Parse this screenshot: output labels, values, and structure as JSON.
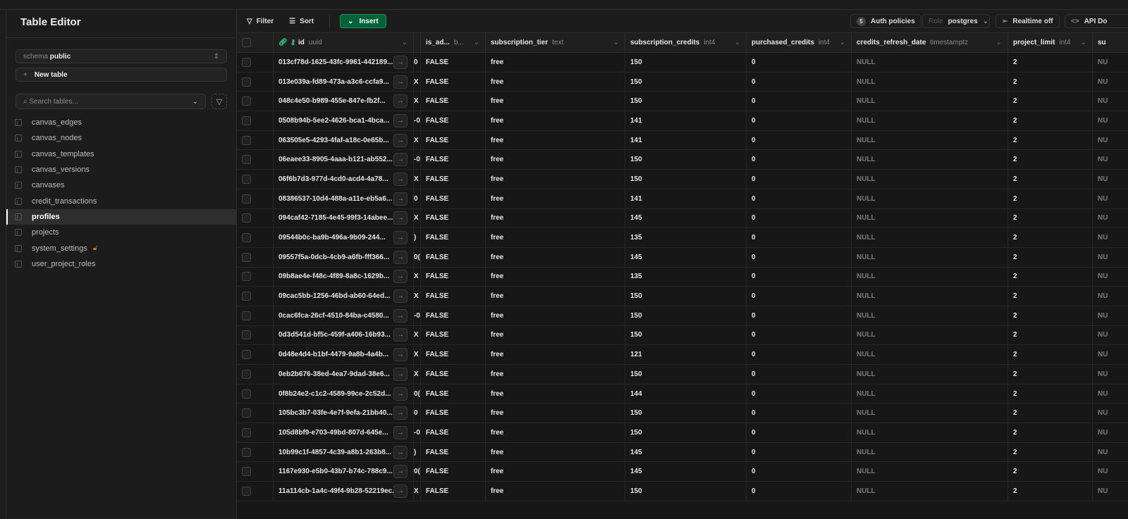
{
  "sidebar": {
    "title": "Table Editor",
    "schema_label": "schema",
    "schema_value": "public",
    "new_table": "New table",
    "search_placeholder": "Search tables...",
    "tables": [
      {
        "name": "canvas_edges"
      },
      {
        "name": "canvas_nodes"
      },
      {
        "name": "canvas_templates"
      },
      {
        "name": "canvas_versions"
      },
      {
        "name": "canvases"
      },
      {
        "name": "credit_transactions"
      },
      {
        "name": "profiles",
        "active": true
      },
      {
        "name": "projects"
      },
      {
        "name": "system_settings",
        "locked": true
      },
      {
        "name": "user_project_roles"
      }
    ]
  },
  "toolbar": {
    "filter": "Filter",
    "sort": "Sort",
    "insert": "Insert",
    "auth_count": "5",
    "auth_policies": "Auth policies",
    "role_label": "Role",
    "role_value": "postgres",
    "realtime": "Realtime off",
    "api_docs": "API Do"
  },
  "colors": {
    "accent": "#006239",
    "lock": "#c27c1a"
  },
  "columns": [
    {
      "name": "id",
      "type": "uuid"
    },
    {
      "name": "is_ad...",
      "type": "b..."
    },
    {
      "name": "subscription_tier",
      "type": "text"
    },
    {
      "name": "subscription_credits",
      "type": "int4"
    },
    {
      "name": "purchased_credits",
      "type": "int4"
    },
    {
      "name": "credits_refresh_date",
      "type": "timestamptz"
    },
    {
      "name": "project_limit",
      "type": "int4"
    },
    {
      "name": "su",
      "type": ""
    }
  ],
  "rows": [
    {
      "id": "013cf78d-1625-43fc-9961-442189...",
      "frag": "0",
      "credits": "150"
    },
    {
      "id": "013e039a-fd89-473a-a3c6-ccfa9...",
      "frag": "X",
      "credits": "150"
    },
    {
      "id": "048c4e50-b989-455e-847e-fb2f...",
      "frag": "X",
      "credits": "150"
    },
    {
      "id": "0508b94b-5ee2-4626-bca1-4bca...",
      "frag": "-0",
      "credits": "141"
    },
    {
      "id": "063505e5-4293-4faf-a18c-0e65b...",
      "frag": "X",
      "credits": "141"
    },
    {
      "id": "06eaee33-8905-4aaa-b121-ab552...",
      "frag": "-0",
      "credits": "150"
    },
    {
      "id": "06f6b7d3-977d-4cd0-acd4-4a78...",
      "frag": "X",
      "credits": "150"
    },
    {
      "id": "08386537-10d4-488a-a11e-eb5a6...",
      "frag": "0",
      "credits": "141"
    },
    {
      "id": "094caf42-7185-4e45-99f3-14abee...",
      "frag": "X",
      "credits": "145"
    },
    {
      "id": "09544b0c-ba9b-496a-9b09-244...",
      "frag": ")",
      "credits": "135"
    },
    {
      "id": "09557f5a-0dcb-4cb9-a6fb-fff366...",
      "frag": "0(",
      "credits": "145"
    },
    {
      "id": "09b8ae4e-f48c-4f89-8a8c-1629b...",
      "frag": "X",
      "credits": "135"
    },
    {
      "id": "09cac5bb-1256-46bd-ab60-64ed...",
      "frag": "X",
      "credits": "150"
    },
    {
      "id": "0cac6fca-26cf-4510-84ba-c4580...",
      "frag": "-0",
      "credits": "150"
    },
    {
      "id": "0d3d541d-bf5c-459f-a406-16b93...",
      "frag": "X",
      "credits": "150"
    },
    {
      "id": "0d48e4d4-b1bf-4479-9a8b-4a4b...",
      "frag": "X",
      "credits": "121"
    },
    {
      "id": "0eb2b676-38ed-4ea7-9dad-38e6...",
      "frag": "X",
      "credits": "150"
    },
    {
      "id": "0f8b24e2-c1c2-4589-99ce-2c52d...",
      "frag": "0(",
      "credits": "144"
    },
    {
      "id": "105bc3b7-03fe-4e7f-9efa-21bb40...",
      "frag": "0",
      "credits": "150"
    },
    {
      "id": "105d8bf9-e703-49bd-807d-645e...",
      "frag": "-0",
      "credits": "150"
    },
    {
      "id": "10b99c1f-4857-4c39-a8b1-263b8...",
      "frag": ")",
      "credits": "145"
    },
    {
      "id": "1167e930-e5b0-43b7-b74c-788c9...",
      "frag": "0(",
      "credits": "145"
    },
    {
      "id": "11a114cb-1a4c-49f4-9b28-52219ec...",
      "frag": "X",
      "credits": "150"
    }
  ],
  "row_defaults": {
    "is_admin": "FALSE",
    "tier": "free",
    "purchased": "0",
    "refresh": "NULL",
    "limit": "2",
    "su": "NU"
  }
}
